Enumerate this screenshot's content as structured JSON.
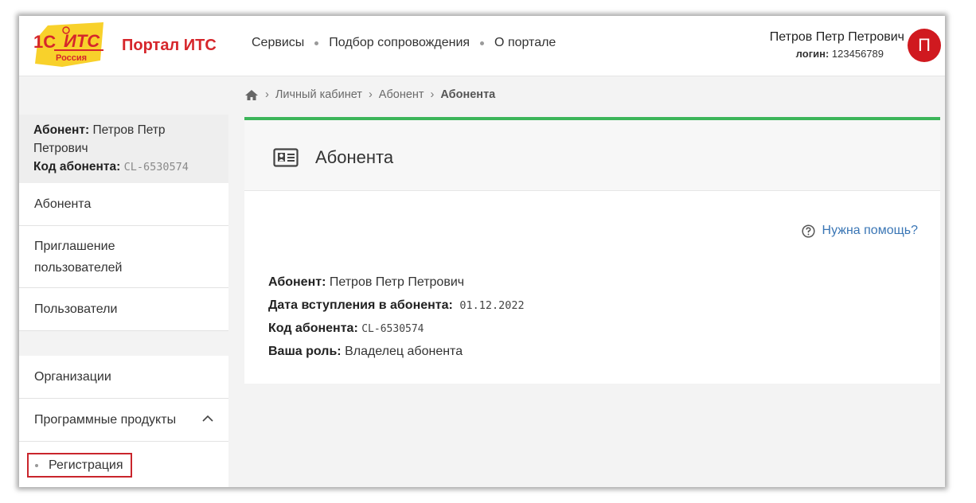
{
  "header": {
    "logo_text": "1С:ИТС",
    "logo_sub": "Россия",
    "brand": "Портал ИТС",
    "nav": [
      "Сервисы",
      "Подбор сопровождения",
      "О портале"
    ],
    "user_name": "Петров Петр Петрович",
    "login_label": "логин:",
    "login_value": "123456789",
    "avatar_letter": "П"
  },
  "sidebar": {
    "subscriber_label": "Абонент:",
    "subscriber_name": "Петров Петр Петрович",
    "code_label": "Код абонента:",
    "code_value": "CL-6530574",
    "items": [
      "Абонента",
      "Приглашение пользователей",
      "Пользователи",
      "Организации",
      "Программные продукты"
    ],
    "sub_item": "Регистрация"
  },
  "breadcrumb": {
    "items": [
      "Личный кабинет",
      "Абонент"
    ],
    "current": "Абонента"
  },
  "card": {
    "title": "Абонента",
    "help": "Нужна помощь?",
    "details": [
      {
        "label": "Абонент:",
        "value": "Петров Петр Петрович"
      },
      {
        "label": "Дата вступления в абонента:",
        "value": "01.12.2022"
      },
      {
        "label": "Код абонента:",
        "value": "CL-6530574"
      },
      {
        "label": "Ваша роль:",
        "value": "Владелец абонента"
      }
    ]
  },
  "colors": {
    "brand_red": "#d6262b",
    "accent_green": "#3cb55a",
    "link_blue": "#3a76b5",
    "highlight_box": "#c9252c"
  },
  "icons": [
    "home-icon",
    "chevron-right-icon",
    "contact-card-icon",
    "help-circle-icon",
    "chevron-up-icon"
  ]
}
